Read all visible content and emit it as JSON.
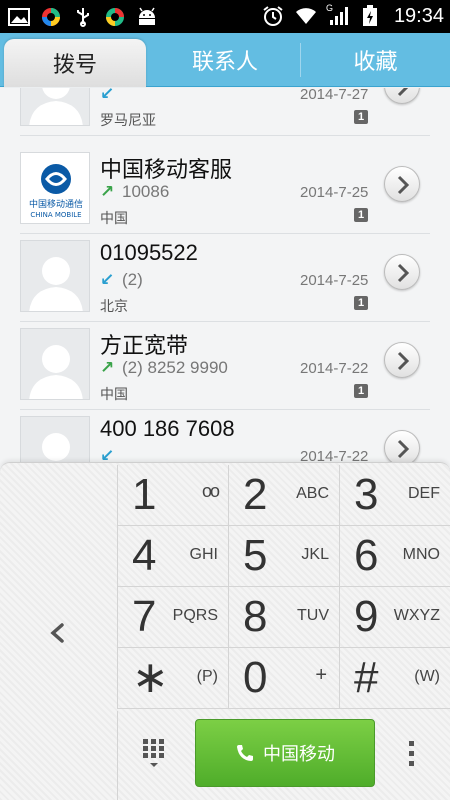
{
  "status_bar": {
    "time": "19:34",
    "signal_label": "G",
    "battery_color": "#ffffff"
  },
  "tabs": [
    {
      "label": "拨号",
      "active": true
    },
    {
      "label": "联系人",
      "active": false
    },
    {
      "label": "收藏",
      "active": false
    }
  ],
  "calls": [
    {
      "name": "",
      "number": "",
      "direction": "in",
      "date": "2014-7-27",
      "location": "罗马尼亚",
      "sim": "1",
      "avatar": "default"
    },
    {
      "name": "中国移动客服",
      "number": "10086",
      "direction": "out",
      "date": "2014-7-25",
      "location": "中国",
      "sim": "1",
      "avatar": "china-mobile",
      "logo_text_cn": "中国移动通信",
      "logo_text_en": "CHINA MOBILE"
    },
    {
      "name": "01095522",
      "number": "(2)",
      "direction": "in",
      "date": "2014-7-25",
      "location": "北京",
      "sim": "1",
      "avatar": "default"
    },
    {
      "name": "方正宽带",
      "number": "(2) 8252 9990",
      "direction": "out",
      "date": "2014-7-22",
      "location": "中国",
      "sim": "1",
      "avatar": "default"
    },
    {
      "name": "400 186 7608",
      "number": "",
      "direction": "in",
      "date": "2014-7-22",
      "location": "",
      "sim": "",
      "avatar": "default"
    }
  ],
  "dialpad": {
    "keys": [
      {
        "digit": "1",
        "letters": "oo"
      },
      {
        "digit": "2",
        "letters": "ABC"
      },
      {
        "digit": "3",
        "letters": "DEF"
      },
      {
        "digit": "4",
        "letters": "GHI"
      },
      {
        "digit": "5",
        "letters": "JKL"
      },
      {
        "digit": "6",
        "letters": "MNO"
      },
      {
        "digit": "7",
        "letters": "PQRS"
      },
      {
        "digit": "8",
        "letters": "TUV"
      },
      {
        "digit": "9",
        "letters": "WXYZ"
      },
      {
        "digit": "∗",
        "letters": "(P)"
      },
      {
        "digit": "0",
        "letters": "+"
      },
      {
        "digit": "#",
        "letters": "(W)"
      }
    ],
    "call_button_label": "中国移动",
    "call_color": "#5cb832"
  },
  "colors": {
    "tab_bar": "#63bde2",
    "outgoing_arrow": "#3aa34a",
    "incoming_arrow": "#2a9fd0"
  }
}
